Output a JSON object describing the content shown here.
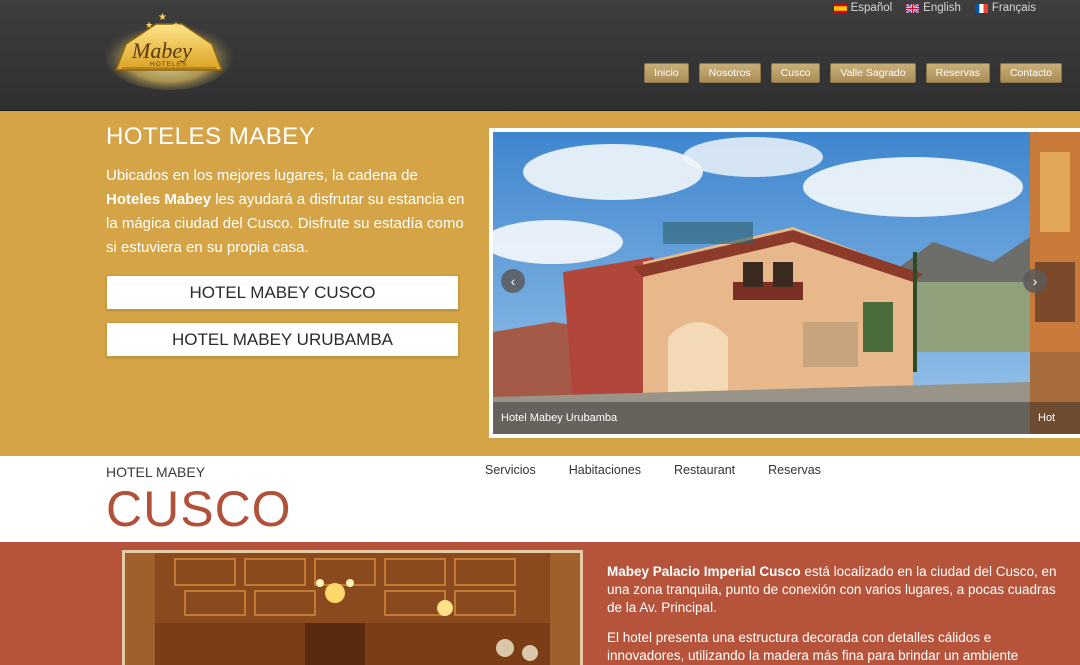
{
  "header": {
    "logo": {
      "text": "Mabey",
      "subtext": "HOTELES"
    },
    "languages": [
      {
        "label": "Español",
        "flag": "spain-flag-icon"
      },
      {
        "label": "English",
        "flag": "uk-flag-icon"
      },
      {
        "label": "Français",
        "flag": "france-flag-icon"
      }
    ],
    "nav": [
      "Inicio",
      "Nosotros",
      "Cusco",
      "Valle Sagrado",
      "Reservas",
      "Contacto"
    ]
  },
  "hero": {
    "title": "HOTELES MABEY",
    "intro_before": "Ubicados en los mejores lugares, la cadena de",
    "intro_bold": "Hoteles Mabey",
    "intro_after": "les ayudará a disfrutar su estancia en la mágica ciudad del Cusco. Disfrute su estadía como si estuviera en su propia casa.",
    "buttons": [
      "HOTEL MABEY CUSCO",
      "HOTEL MABEY URUBAMBA"
    ],
    "slider": {
      "caption": "Hotel Mabey Urubamba",
      "next_caption": "Hot",
      "prev_icon": "chevron-left-icon",
      "next_icon": "chevron-right-icon"
    }
  },
  "section": {
    "small_title": "HOTEL MABEY",
    "big_title": "CUSCO",
    "subnav": [
      "Servicios",
      "Habitaciones",
      "Restaurant",
      "Reservas"
    ]
  },
  "content": {
    "p1_bold": "Mabey Palacio Imperial Cusco",
    "p1_rest": "está localizado en la ciudad del Cusco, en una zona tranquila, punto de conexión con varios lugares, a pocas cuadras de la Av. Principal.",
    "p2": "El hotel presenta una estructura decorada con detalles cálidos e innovadores, utilizando la madera más fina para brindar un ambiente"
  },
  "colors": {
    "header_bg": "#383838",
    "gold": "#d4a446",
    "rust": "#b6543b",
    "title_rust": "#b1513a",
    "nav_button": "#b89c66"
  }
}
